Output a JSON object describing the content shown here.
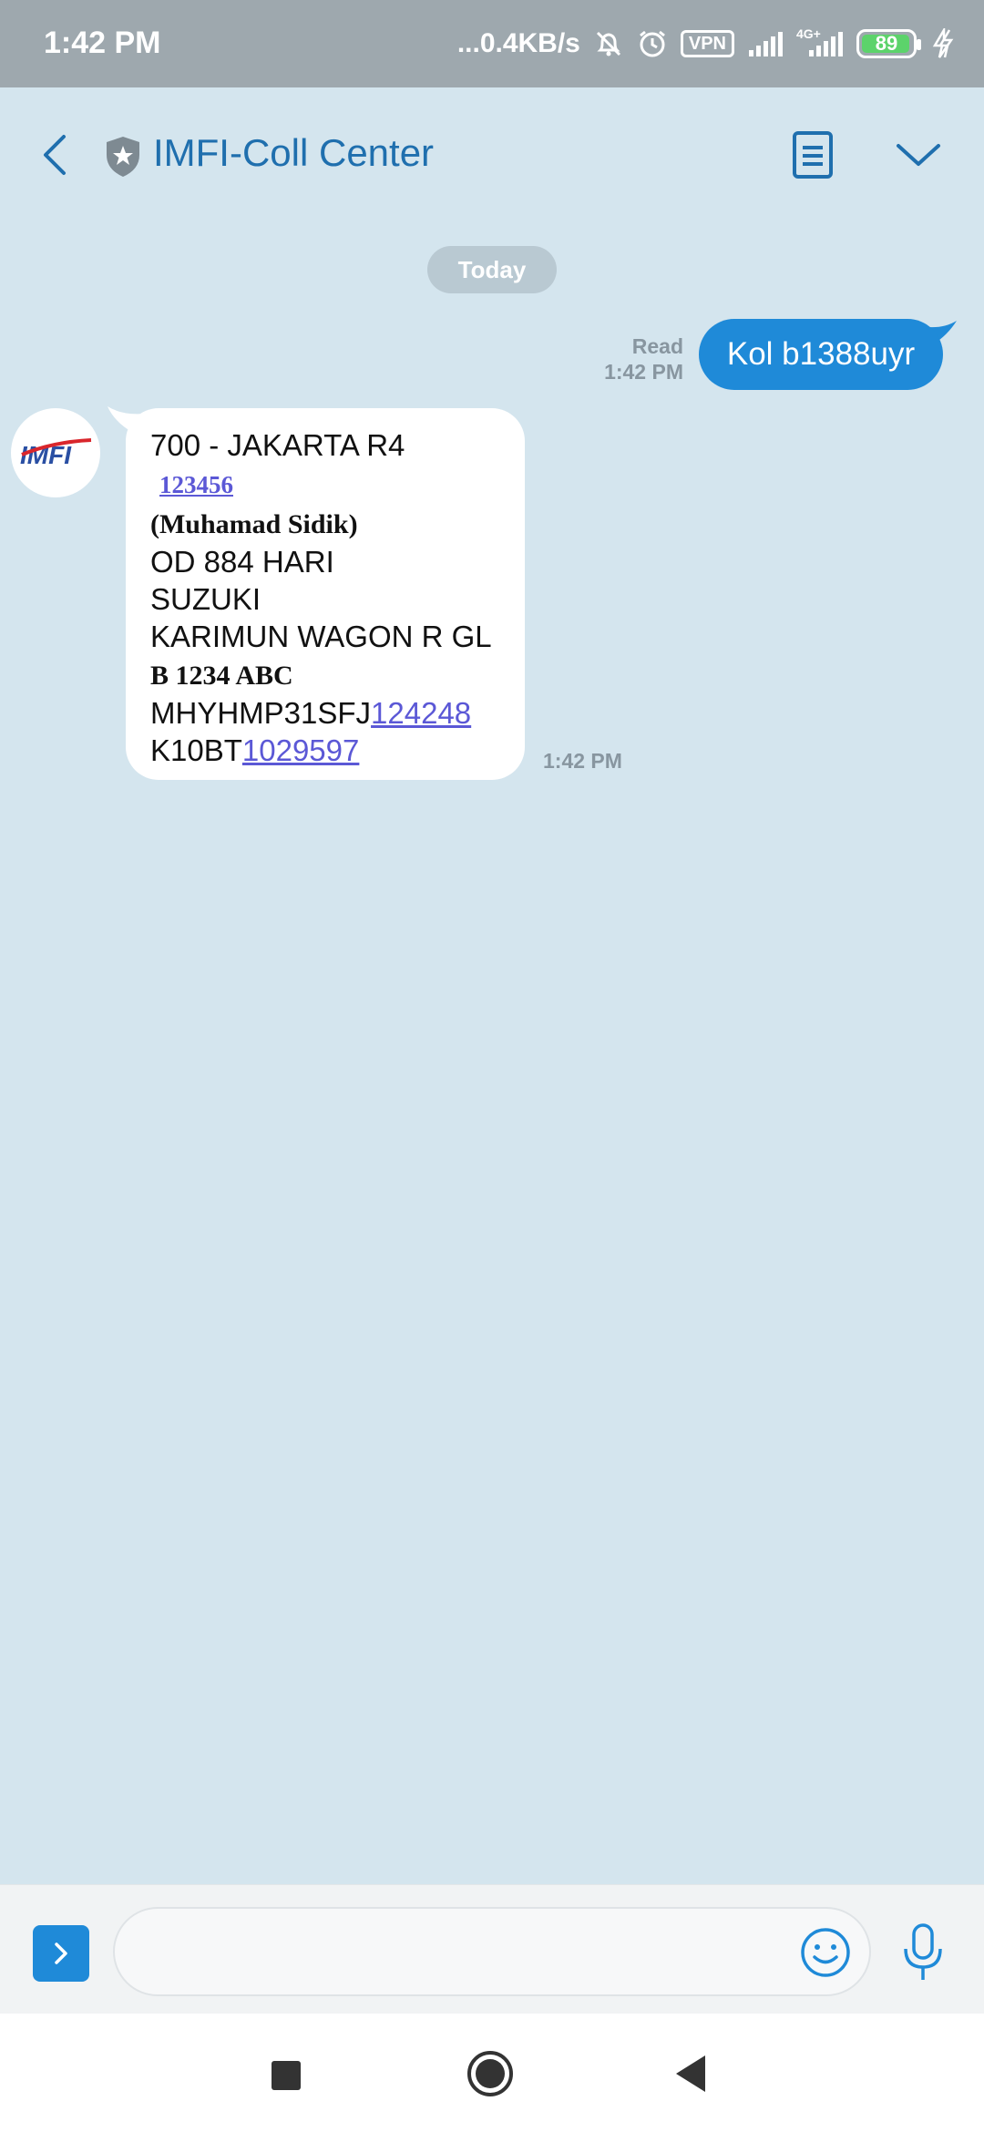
{
  "status_bar": {
    "time": "1:42 PM",
    "network_speed": "...0.4KB/s",
    "vpn_label": "VPN",
    "network_type": "4G+",
    "battery": "89"
  },
  "header": {
    "title": "IMFI-Coll Center"
  },
  "chat": {
    "date_label": "Today",
    "outgoing": {
      "status": "Read",
      "time": "1:42 PM",
      "text": "Kol b1388uyr"
    },
    "incoming": {
      "avatar_text": "IMFI",
      "time": "1:42 PM",
      "lines": {
        "l1": "700 - JAKARTA R4",
        "l2": "123456",
        "l3": "(Muhamad Sidik)",
        "l4": "OD 884 HARI",
        "l5": "SUZUKI",
        "l6": "KARIMUN WAGON R GL",
        "l7": "B 1234 ABC",
        "l8_prefix": "MHYHMP31SFJ",
        "l8_link": "124248",
        "l9_prefix": "K10BT",
        "l9_link": "1029597"
      }
    }
  },
  "input": {
    "placeholder": ""
  },
  "colors": {
    "accent": "#1f8ad8",
    "background": "#d4e5ee",
    "title": "#1f6fae",
    "link": "#5b58d6"
  },
  "icons": [
    "back-arrow-icon",
    "shield-star-icon",
    "note-icon",
    "chevron-down-icon",
    "expand-icon",
    "emoji-icon",
    "mic-icon"
  ]
}
